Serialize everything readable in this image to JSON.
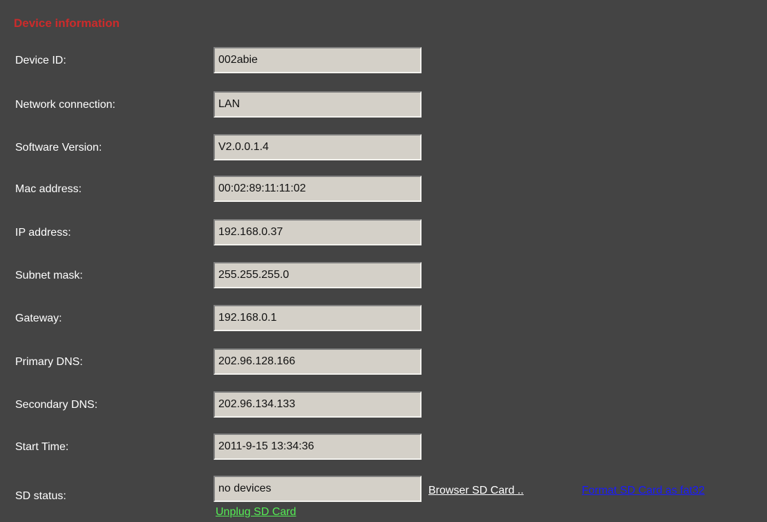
{
  "section_title": "Device information",
  "colors": {
    "background": "#444444",
    "title": "#cc2b2b",
    "label": "#ffffff",
    "field_background": "#d4d0c8",
    "browse_link": "#ffffff",
    "format_link": "#1a1aff",
    "unplug_link": "#55ee55"
  },
  "fields": [
    {
      "label": "Device ID:",
      "value": "002abie"
    },
    {
      "label": "Network connection:",
      "value": "LAN"
    },
    {
      "label": "Software Version:",
      "value": "V2.0.0.1.4"
    },
    {
      "label": "Mac address:",
      "value": "00:02:89:11:11:02"
    },
    {
      "label": "IP address:",
      "value": "192.168.0.37"
    },
    {
      "label": "Subnet mask:",
      "value": "255.255.255.0"
    },
    {
      "label": "Gateway:",
      "value": "192.168.0.1"
    },
    {
      "label": "Primary DNS:",
      "value": "202.96.128.166"
    },
    {
      "label": "Secondary DNS:",
      "value": "202.96.134.133"
    },
    {
      "label": "Start Time:",
      "value": "2011-9-15 13:34:36"
    },
    {
      "label": "SD status:",
      "value": "no devices"
    }
  ],
  "sd_links": {
    "browse": "Browser SD Card ..",
    "format": "Format SD Card as fat32",
    "unplug": "Unplug SD Card"
  }
}
